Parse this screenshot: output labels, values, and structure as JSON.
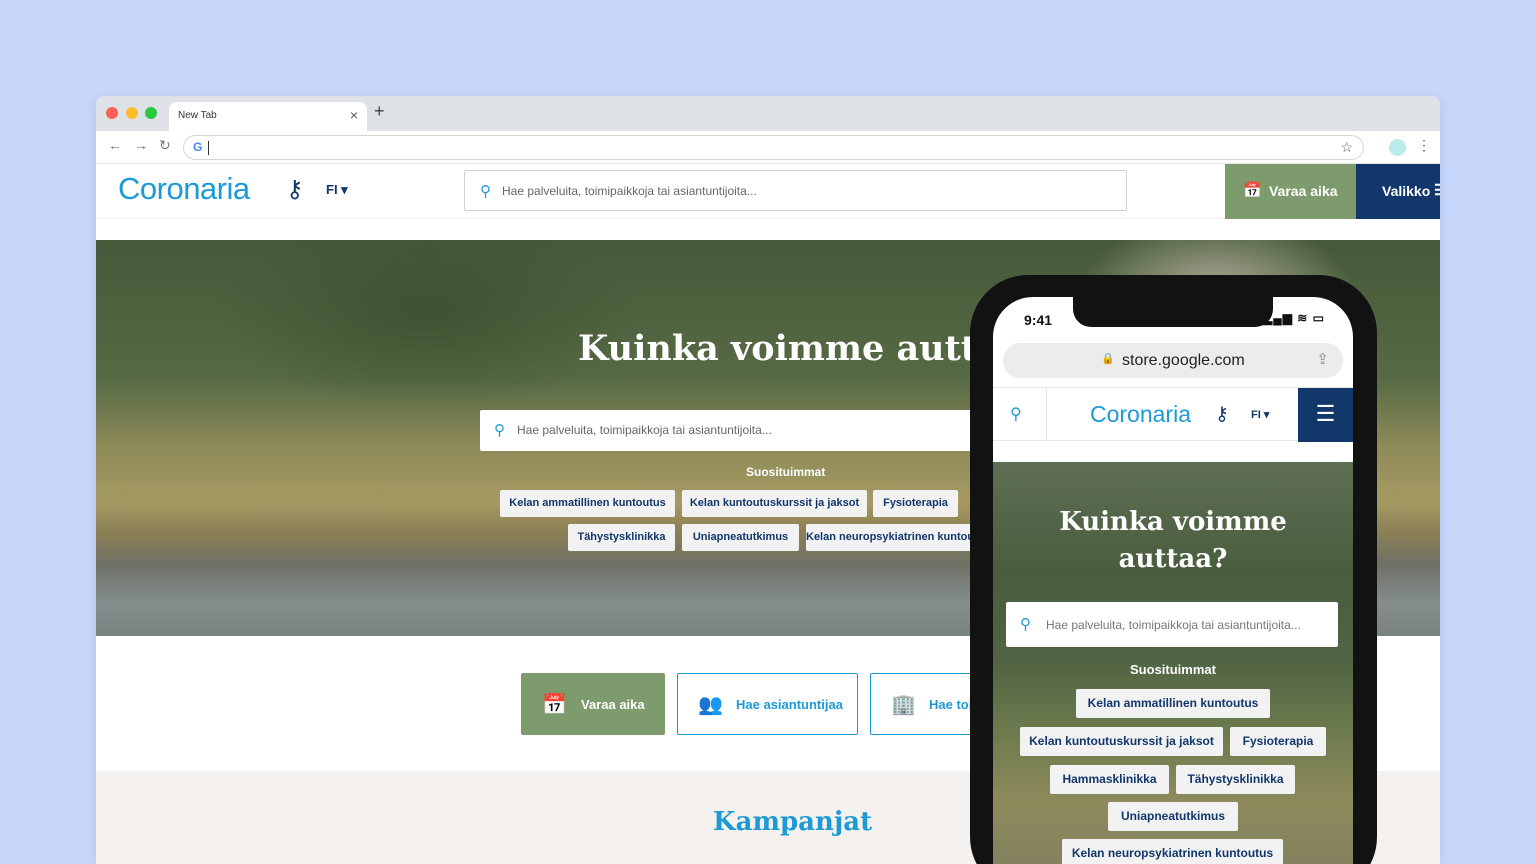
{
  "browser": {
    "tab_title": "New Tab",
    "tab_close": "×",
    "new_tab": "+",
    "back": "←",
    "forward": "→",
    "reload": "↻",
    "google_glyph": "G",
    "star": "☆",
    "menu": "⋮"
  },
  "header": {
    "logo": "Coronaria",
    "logo_mark": "⚷",
    "lang": "FI ▾",
    "search_placeholder": "Hae palveluita, toimipaikkoja tai asiantuntijoita...",
    "book_button": "Varaa aika",
    "menu_button": "Valikko",
    "menu_icon": "☰"
  },
  "hero": {
    "title": "Kuinka voimme auttaa?",
    "search_placeholder": "Hae palveluita, toimipaikkoja tai asiantuntijoita...",
    "popular_label": "Suosituimmat",
    "chips": [
      "Kelan ammatillinen kuntoutus",
      "Kelan kuntoutuskurssit ja jaksot",
      "Fysioterapia",
      "Tähystysklinikka",
      "Uniapneatutkimus",
      "Kelan neuropsykiatrinen kuntoutus"
    ]
  },
  "actions": {
    "book": "Varaa aika",
    "expert": "Hae asiantuntijaa",
    "location": "Hae toimipaikka"
  },
  "campaigns": {
    "title": "Kampanjat"
  },
  "phone": {
    "time": "9:41",
    "status_icons": "▂▄▆ ≋ ▭",
    "url": "store.google.com",
    "lock": "🔒",
    "share": "⇪",
    "logo": "Coronaria",
    "logo_mark": "⚷",
    "lang": "FI ▾",
    "menu_icon": "☰",
    "hero_title_line1": "Kuinka voimme",
    "hero_title_line2": "auttaa?",
    "search_placeholder": "Hae palveluita, toimipaikkoja tai asiantuntijoita...",
    "popular_label": "Suosituimmat",
    "chips": [
      "Kelan ammatillinen kuntoutus",
      "Kelan kuntoutuskurssit ja jaksot",
      "Fysioterapia",
      "Hammasklinikka",
      "Tähystysklinikka",
      "Uniapneatutkimus",
      "Kelan neuropsykiatrinen kuntoutus"
    ]
  },
  "colors": {
    "brand_blue": "#1b9ad6",
    "navy": "#12376b",
    "green": "#7d9b6c",
    "background": "#c7d7fb"
  }
}
